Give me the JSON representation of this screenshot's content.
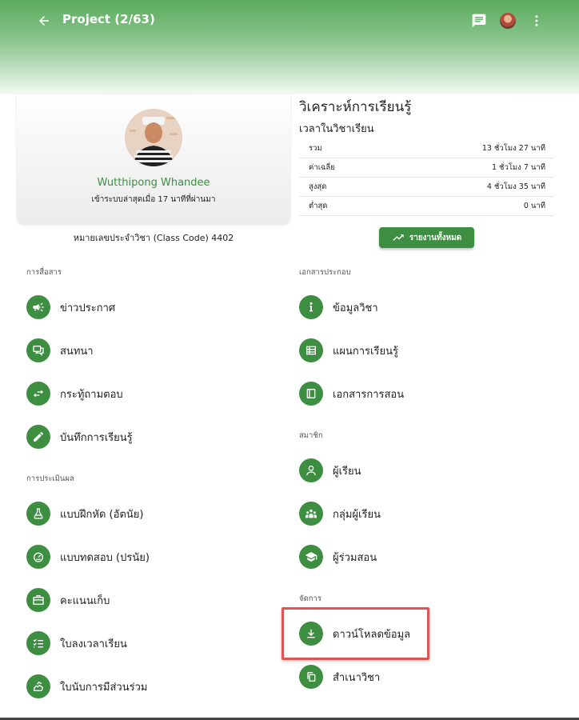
{
  "header": {
    "title": "Project (2/63)",
    "icons": [
      "back-arrow-icon",
      "chat-icon",
      "user-avatar",
      "more-vert-icon"
    ]
  },
  "profile": {
    "name": "Wutthipong Whandee",
    "last_login": "เข้าระบบล่าสุดเมื่อ 17 นาทีที่ผ่านมา",
    "class_code": "หมายเลขประจำวิชา (Class Code) 4402"
  },
  "analytics": {
    "title": "วิเคราะห์การเรียนรู้",
    "subtitle": "เวลาในวิชาเรียน",
    "rows": [
      {
        "label": "รวม",
        "value": "13 ชั่วโมง 27 นาที"
      },
      {
        "label": "ค่าเฉลี่ย",
        "value": "1 ชั่วโมง 7 นาที"
      },
      {
        "label": "สูงสุด",
        "value": "4 ชั่วโมง 35 นาที"
      },
      {
        "label": "ต่ำสุด",
        "value": "0 นาที"
      }
    ],
    "report_button": "รายงานทั้งหมด"
  },
  "sections": {
    "communication": {
      "label": "การสื่อสาร",
      "items": [
        {
          "label": "ข่าวประกาศ",
          "icon": "megaphone-icon"
        },
        {
          "label": "สนทนา",
          "icon": "chat-bubbles-icon"
        },
        {
          "label": "กระทู้ถามตอบ",
          "icon": "swap-arrows-icon"
        },
        {
          "label": "บันทึกการเรียนรู้",
          "icon": "pencil-icon"
        }
      ]
    },
    "assessment": {
      "label": "การประเมินผล",
      "items": [
        {
          "label": "แบบฝึกหัด (อัตนัย)",
          "icon": "flask-icon"
        },
        {
          "label": "แบบทดสอบ (ปรนัย)",
          "icon": "gauge-icon"
        },
        {
          "label": "คะแนนเก็บ",
          "icon": "briefcase-icon"
        },
        {
          "label": "ใบลงเวลาเรียน",
          "icon": "checklist-icon"
        },
        {
          "label": "ใบนับการมีส่วนร่วม",
          "icon": "hand-icon"
        }
      ]
    },
    "documents": {
      "label": "เอกสารประกอบ",
      "items": [
        {
          "label": "ข้อมูลวิชา",
          "icon": "info-icon"
        },
        {
          "label": "แผนการเรียนรู้",
          "icon": "table-icon"
        },
        {
          "label": "เอกสารการสอน",
          "icon": "book-icon"
        }
      ]
    },
    "members": {
      "label": "สมาชิก",
      "items": [
        {
          "label": "ผู้เรียน",
          "icon": "person-icon"
        },
        {
          "label": "กลุ่มผู้เรียน",
          "icon": "group-icon"
        },
        {
          "label": "ผู้ร่วมสอน",
          "icon": "graduation-cap-icon"
        }
      ]
    },
    "manage": {
      "label": "จัดการ",
      "items": [
        {
          "label": "ดาวน์โหลดข้อมูล",
          "icon": "download-icon"
        },
        {
          "label": "สำเนาวิชา",
          "icon": "copy-icon"
        }
      ]
    }
  },
  "colors": {
    "accent": "#3e8e41",
    "highlight": "#e15454"
  }
}
